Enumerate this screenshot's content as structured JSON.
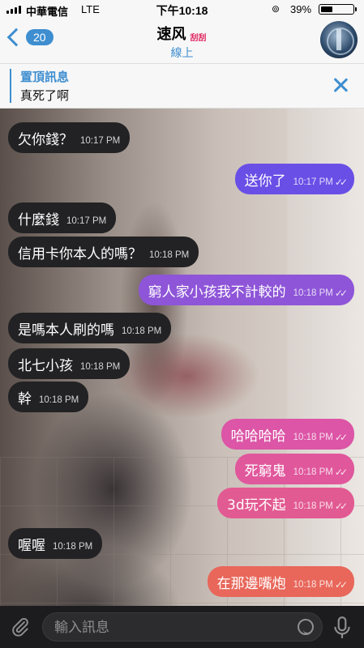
{
  "status_bar": {
    "carrier": "中華電信",
    "network": "LTE",
    "time": "下午10:18",
    "battery_text": "39%",
    "battery_level": 0.39
  },
  "header": {
    "back_count": "20",
    "chat_name": "速风",
    "emblem_text": "刮刮",
    "status": "線上"
  },
  "pinned": {
    "title": "置頂訊息",
    "text": "真死了啊"
  },
  "colors": {
    "accent": "#3e8ed0",
    "incoming_bubble": "#222224",
    "outgoing_purple_top": "#7b4fe0",
    "outgoing_purple_bottom": "#9b59d6",
    "outgoing_pink": "#e0559a",
    "outgoing_coral": "#e8665a"
  },
  "messages": [
    {
      "dir": "in",
      "text": "欠你錢？",
      "time": "10:17 PM"
    },
    {
      "dir": "out",
      "text": "送你了",
      "time": "10:17 PM",
      "read": true,
      "color": "#6a4fe6"
    },
    {
      "dir": "in",
      "text": "什麼錢",
      "time": "10:17 PM"
    },
    {
      "dir": "in",
      "text": "信用卡你本人的嗎？",
      "time": "10:18 PM"
    },
    {
      "dir": "out",
      "text": "窮人家小孩我不計較的",
      "time": "10:18 PM",
      "read": true,
      "color": "#8e55d8"
    },
    {
      "dir": "in",
      "text": "是嗎本人刷的嗎",
      "time": "10:18 PM"
    },
    {
      "dir": "in",
      "text": "北七小孩",
      "time": "10:18 PM"
    },
    {
      "dir": "in",
      "text": "幹",
      "time": "10:18 PM"
    },
    {
      "dir": "out",
      "text": "哈哈哈哈",
      "time": "10:18 PM",
      "read": true,
      "color": "#dc55a6"
    },
    {
      "dir": "out",
      "text": "死窮鬼",
      "time": "10:18 PM",
      "read": true,
      "color": "#e0579c"
    },
    {
      "dir": "out",
      "text": "3d玩不起",
      "time": "10:18 PM",
      "read": true,
      "color": "#e25a92"
    },
    {
      "dir": "in",
      "text": "喔喔",
      "time": "10:18 PM"
    },
    {
      "dir": "out",
      "text": "在那邊嘴炮",
      "time": "10:18 PM",
      "read": true,
      "color": "#e8675a"
    }
  ],
  "composer": {
    "placeholder": "輸入訊息"
  },
  "icons": {
    "attach": "paperclip-icon",
    "sticker": "sticker-icon",
    "mic": "microphone-icon",
    "back": "chevron-left-icon",
    "close": "close-icon"
  }
}
